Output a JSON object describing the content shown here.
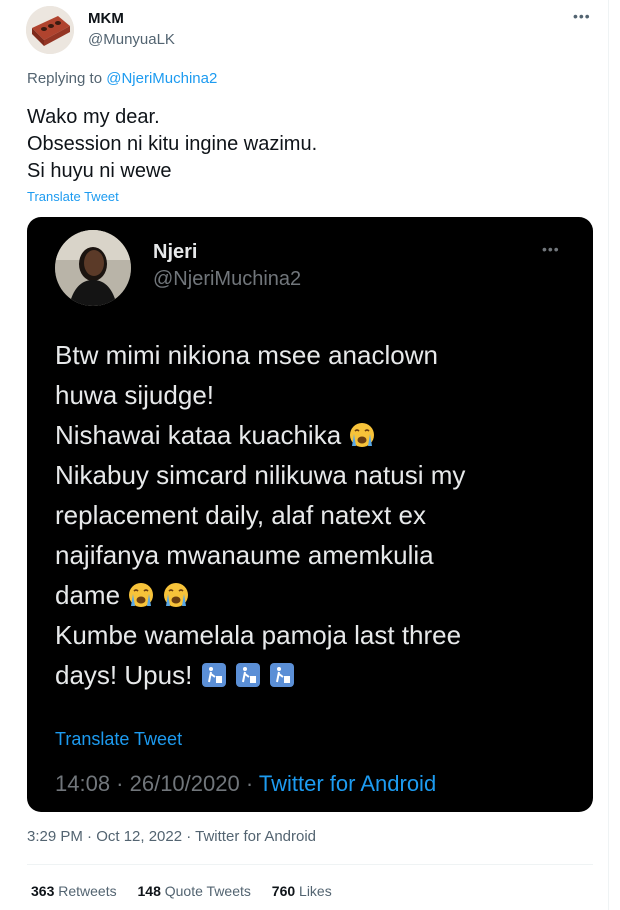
{
  "author": {
    "name": "MKM",
    "handle": "@MunyuaLK"
  },
  "more_icon": "ellipsis-icon",
  "replying": {
    "prefix": "Replying to",
    "handle": "@NjeriMuchina2"
  },
  "tweet_lines": [
    "Wako my dear.",
    "Obsession ni kitu ingine wazimu.",
    "Si huyu ni wewe"
  ],
  "translate_label": "Translate Tweet",
  "screenshot": {
    "name": "Njeri",
    "handle": "@NjeriMuchina2",
    "lines": [
      "Btw mimi nikiona msee anaclown",
      "huwa sijudge!",
      "Nishawai kataa kuachika",
      "Nikabuy simcard nilikuwa natusi my",
      "replacement daily, alaf natext ex",
      "najifanya mwanaume amemkulia",
      "dame",
      "Kumbe wamelala pamoja last three",
      "days! Upus!"
    ],
    "translate_label": "Translate Tweet",
    "time": "14:08 · 26/10/2020 ·",
    "source": "Twitter for Android"
  },
  "meta": "3:29 PM · Oct 12, 2022 · Twitter for Android",
  "stats": {
    "retweets_count": "363",
    "retweets_label": "Retweets",
    "quotes_count": "148",
    "quotes_label": "Quote Tweets",
    "likes_count": "760",
    "likes_label": "Likes"
  },
  "colors": {
    "link": "#1d9bf0",
    "secondary": "#536471",
    "dark_bg": "#000000"
  }
}
